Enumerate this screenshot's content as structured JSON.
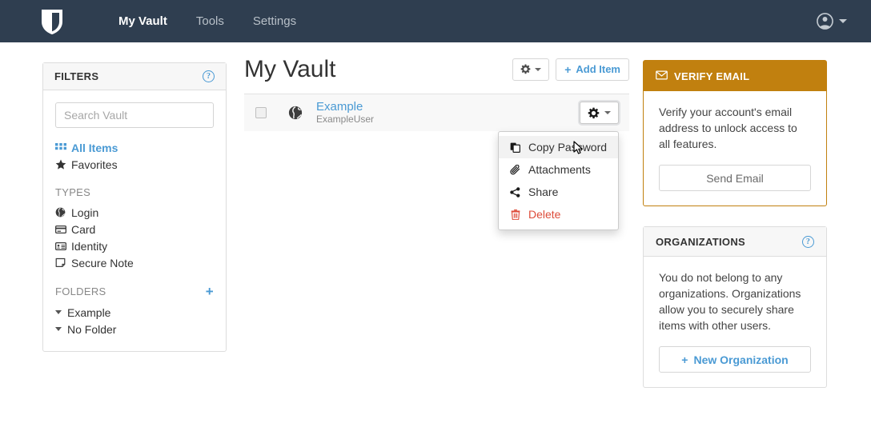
{
  "navbar": {
    "logo_icon": "shield-icon",
    "links": [
      {
        "label": "My Vault",
        "active": true
      },
      {
        "label": "Tools",
        "active": false
      },
      {
        "label": "Settings",
        "active": false
      }
    ],
    "account_icon": "user-circle-icon",
    "accent_dark": "#2f3e50"
  },
  "filters": {
    "title": "FILTERS",
    "help_icon": "question-circle-icon",
    "search": {
      "placeholder": "Search Vault",
      "value": ""
    },
    "nav": [
      {
        "label": "All Items",
        "icon": "grid-icon",
        "active": true
      },
      {
        "label": "Favorites",
        "icon": "star-icon",
        "active": false
      }
    ],
    "types_label": "TYPES",
    "types": [
      {
        "label": "Login",
        "icon": "globe-icon"
      },
      {
        "label": "Card",
        "icon": "credit-card-icon"
      },
      {
        "label": "Identity",
        "icon": "id-card-icon"
      },
      {
        "label": "Secure Note",
        "icon": "sticky-note-icon"
      }
    ],
    "folders_label": "FOLDERS",
    "folders_add_icon": "plus-icon",
    "folders": [
      {
        "label": "Example",
        "icon": "caret-down-icon"
      },
      {
        "label": "No Folder",
        "icon": "caret-down-icon"
      }
    ]
  },
  "vault": {
    "title": "My Vault",
    "options_button": {
      "icon": "gear-icon",
      "caret": "caret-down-icon"
    },
    "add_item_button": {
      "label": "Add Item",
      "icon": "plus-icon"
    },
    "items": [
      {
        "name": "Example",
        "username": "ExampleUser",
        "icon": "globe-icon",
        "checked": false,
        "row_menu_icon": "gear-icon"
      }
    ]
  },
  "dropdown": {
    "items": [
      {
        "label": "Copy Password",
        "icon": "copy-icon",
        "highlighted": true,
        "danger": false
      },
      {
        "label": "Attachments",
        "icon": "paperclip-icon",
        "highlighted": false,
        "danger": false
      },
      {
        "label": "Share",
        "icon": "share-icon",
        "highlighted": false,
        "danger": false
      },
      {
        "label": "Delete",
        "icon": "trash-icon",
        "highlighted": false,
        "danger": true
      }
    ],
    "danger_color": "#dd4b39"
  },
  "verify_email": {
    "title": "VERIFY EMAIL",
    "icon": "envelope-icon",
    "body": "Verify your account's email address to unlock access to all features.",
    "button_label": "Send Email",
    "header_color": "#c1800f"
  },
  "organizations": {
    "title": "ORGANIZATIONS",
    "help_icon": "question-circle-icon",
    "body": "You do not belong to any organizations. Organizations allow you to securely share items with other users.",
    "button_label": "New Organization",
    "button_icon": "plus-icon",
    "accent_color": "#4a9ad4"
  }
}
